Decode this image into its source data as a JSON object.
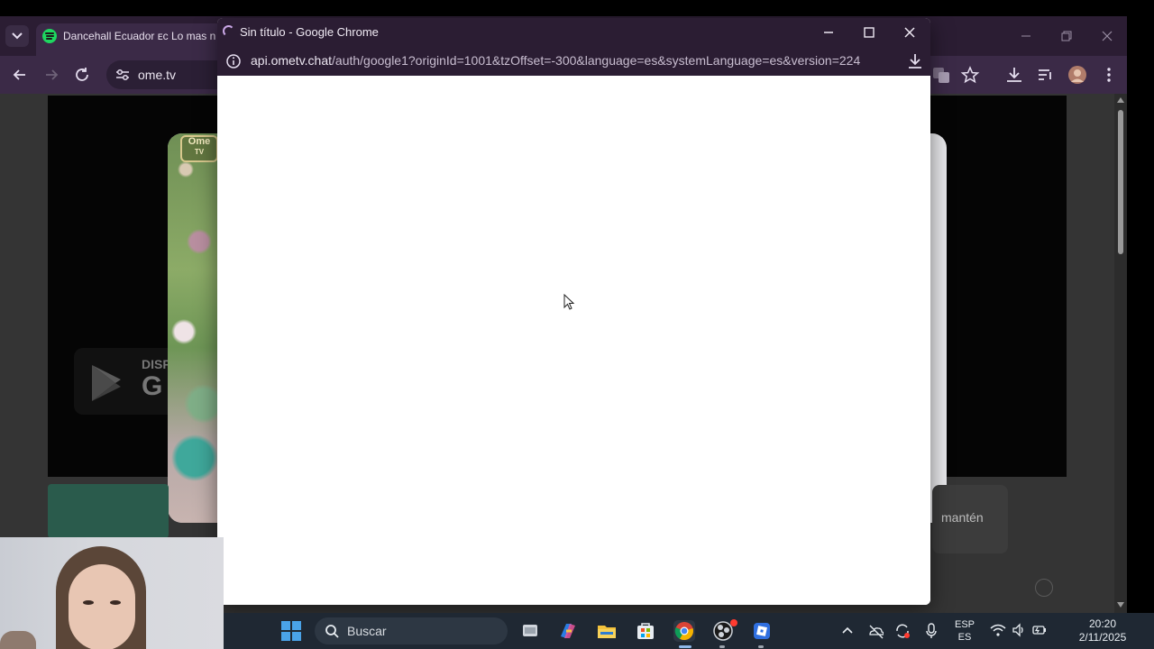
{
  "background_browser": {
    "tab_title": "Dancehall Ecuador ᴇᴄ Lo mas n",
    "url": "ome.tv",
    "store_badge_text": "DISP",
    "store_badge_letter": "G",
    "chat_hint_text": "mantén"
  },
  "stranger_video": {
    "logo_top": "Ome",
    "logo_bottom": "TV"
  },
  "popup": {
    "title": "Sin título - Google Chrome",
    "url_host": "api.ometv.chat",
    "url_path": "/auth/google1?originId=1001&tzOffset=-300&language=es&systemLanguage=es&version=224"
  },
  "taskbar": {
    "search_placeholder": "Buscar",
    "language_line1": "ESP",
    "language_line2": "ES",
    "time": "20:20",
    "date": "2/11/2025"
  },
  "colors": {
    "browser_frame": "#2b1d33",
    "browser_toolbar": "#3b2a47",
    "taskbar": "#1f2833",
    "spotify": "#1ed760"
  }
}
